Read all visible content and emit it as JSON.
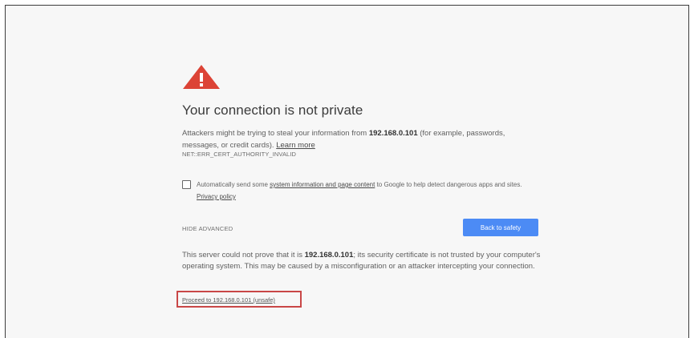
{
  "page": {
    "title": "Your connection is not private",
    "intro_prefix": "Attackers might be trying to steal your information from ",
    "host": "192.168.0.101",
    "intro_suffix": " (for example, passwords, messages, or credit cards). ",
    "learn_more": "Learn more",
    "error_code": "NET::ERR_CERT_AUTHORITY_INVALID"
  },
  "report": {
    "checked": false,
    "text_prefix": "Automatically send some ",
    "system_info_link": "system information and page content",
    "text_middle": " to Google to help detect dangerous apps and sites. ",
    "privacy_link": "Privacy policy"
  },
  "actions": {
    "hide_advanced": "HIDE ADVANCED",
    "back_to_safety": "Back to safety"
  },
  "details": {
    "prefix": "This server could not prove that it is ",
    "host": "192.168.0.101",
    "suffix": "; its security certificate is not trusted by your computer's operating system. This may be caused by a misconfiguration or an attacker intercepting your connection.",
    "proceed_link": "Proceed to 192.168.0.101 (unsafe)"
  },
  "colors": {
    "warning_red": "#dc4336",
    "button_blue": "#4c8bf5",
    "highlight_red": "#c94747"
  },
  "icons": {
    "warning": "warning-triangle-icon"
  }
}
